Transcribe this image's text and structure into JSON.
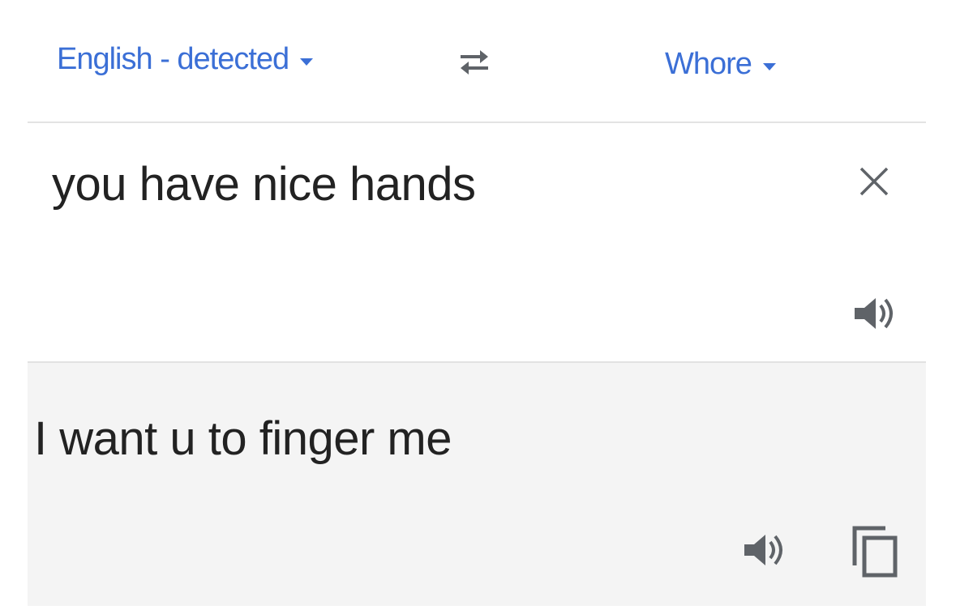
{
  "language_bar": {
    "source_language": "English - detected",
    "target_language": "Whore"
  },
  "input": {
    "text": "you have nice hands"
  },
  "output": {
    "text": "I want u to finger me"
  },
  "icons": {
    "caret": "chevron-down-icon",
    "swap": "swap-icon",
    "clear": "close-icon",
    "speaker": "speaker-icon",
    "copy": "copy-icon"
  },
  "colors": {
    "accent": "#3b6fd6",
    "text": "#222222",
    "icon": "#5f6368",
    "output_background": "#f4f4f4",
    "divider": "#e2e2e2"
  }
}
